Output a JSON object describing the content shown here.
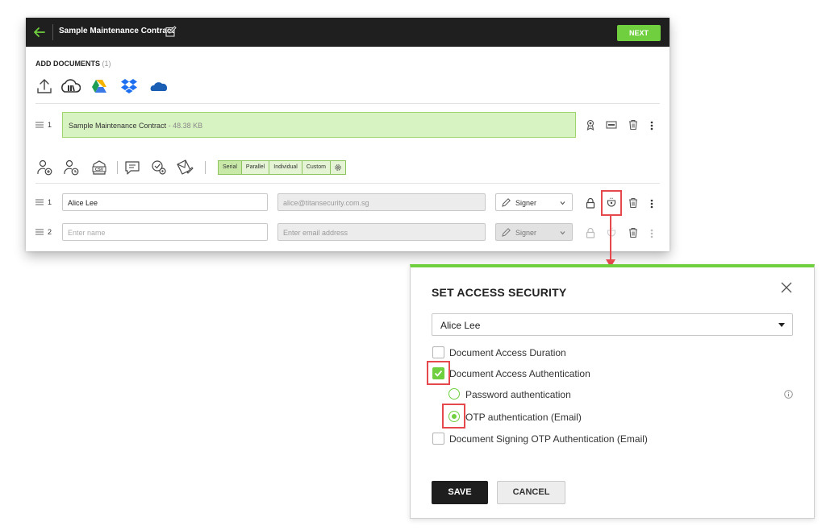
{
  "header": {
    "title": "Sample Maintenance Contract",
    "next_label": "NEXT"
  },
  "documents": {
    "heading": "ADD DOCUMENTS",
    "count": "(1)",
    "sources": [
      "upload-icon",
      "cloud-library-icon",
      "google-drive-icon",
      "dropbox-icon",
      "onedrive-icon"
    ],
    "items": [
      {
        "index": "1",
        "name": "Sample Maintenance Contract",
        "size": " - 48.38 KB"
      }
    ]
  },
  "signing_order": {
    "options": [
      "Serial",
      "Parallel",
      "Individual",
      "Custom"
    ],
    "selected": "Serial"
  },
  "recipients": [
    {
      "index": "1",
      "name": "Alice Lee",
      "email": "alice@titansecurity.com.sg",
      "role": "Signer"
    },
    {
      "index": "2",
      "name_placeholder": "Enter name",
      "email_placeholder": "Enter email address",
      "role": "Signer"
    }
  ],
  "dialog": {
    "title": "SET ACCESS SECURITY",
    "recipient": "Alice Lee",
    "options": {
      "duration": {
        "label": "Document Access Duration",
        "checked": false
      },
      "authentication": {
        "label": "Document Access Authentication",
        "checked": true
      },
      "password": {
        "label": "Password authentication",
        "selected": false
      },
      "otp": {
        "label": "OTP authentication (Email)",
        "selected": true
      },
      "signing_otp": {
        "label": "Document Signing OTP Authentication (Email)",
        "checked": false
      }
    },
    "save_label": "SAVE",
    "cancel_label": "CANCEL"
  },
  "colors": {
    "accent": "#6fcf3f",
    "highlight": "#e5484d",
    "topbar": "#1f1f1f"
  }
}
